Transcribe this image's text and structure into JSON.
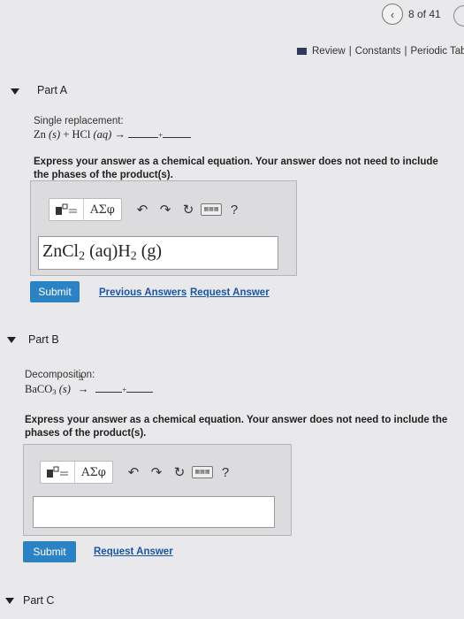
{
  "pager": {
    "prev_icon": "chevron-left-icon",
    "text": "8 of 41"
  },
  "header_links": {
    "review": "Review",
    "sep1": "|",
    "constants": "Constants",
    "sep2": "|",
    "periodic": "Periodic Table"
  },
  "part_a": {
    "title": "Part A",
    "reaction_type": "Single replacement:",
    "eq_zn": "Zn",
    "eq_state_s": "(s)",
    "eq_plus": "+",
    "eq_hcl": "HCl",
    "eq_state_aq": "(aq)",
    "eq_arrow": "→",
    "eq_plus2": "+",
    "instruction": "Express your answer as a chemical equation. Your answer does not need to include the phases of the product(s).",
    "toolbar": {
      "greek_label": "ΑΣφ",
      "help_label": "?"
    },
    "answer": {
      "part1": "ZnCl",
      "sub1": "2",
      "part2": " (aq)H",
      "sub2": "2",
      "part3": " (g)"
    },
    "submit_label": "Submit",
    "previous_answers_label": "Previous Answers",
    "request_answer_label": "Request Answer"
  },
  "part_b": {
    "title": "Part B",
    "reaction_type": "Decomposition:",
    "eq_baco": "BaCO",
    "eq_sub3": "3",
    "eq_state_s": "(s)",
    "eq_delta": "Δ",
    "eq_arrow": "→",
    "eq_plus": "+",
    "instruction": "Express your answer as a chemical equation. Your answer does not need to include the phases of the product(s).",
    "toolbar": {
      "greek_label": "ΑΣφ",
      "help_label": "?"
    },
    "answer_value": "",
    "submit_label": "Submit",
    "request_answer_label": "Request Answer"
  },
  "part_c": {
    "title": "Part C"
  }
}
